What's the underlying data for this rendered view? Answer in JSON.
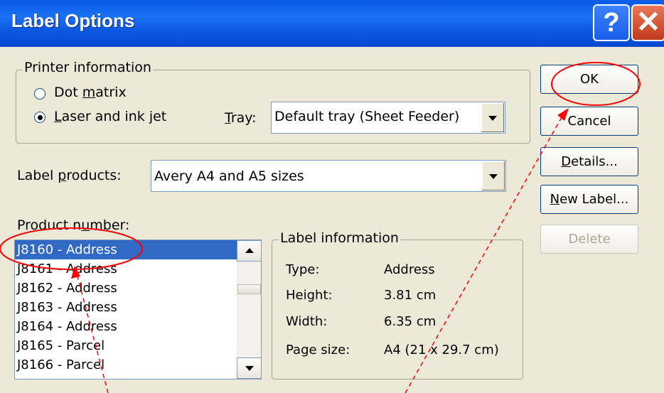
{
  "window": {
    "title": "Label Options"
  },
  "printer_info": {
    "group_title": "Printer information",
    "options": [
      {
        "label_pre": "Dot ",
        "label_u": "m",
        "label_post": "atrix",
        "checked": false
      },
      {
        "label_pre": "",
        "label_u": "L",
        "label_post": "aser and ink jet",
        "checked": true
      }
    ],
    "tray_label_u": "T",
    "tray_label_post": "ray:",
    "tray_value": "Default tray (Sheet Feeder)"
  },
  "label_products": {
    "label_pre": "Label ",
    "label_u": "p",
    "label_post": "roducts:",
    "value": "Avery A4 and A5 sizes"
  },
  "product_number": {
    "label_pre": "Product n",
    "label_u": "u",
    "label_post": "mber:",
    "items": [
      {
        "text": "J8160 - Address",
        "selected": true
      },
      {
        "text": "J8161 - Address",
        "selected": false
      },
      {
        "text": "J8162 - Address",
        "selected": false
      },
      {
        "text": "J8163 - Address",
        "selected": false
      },
      {
        "text": "J8164 - Address",
        "selected": false
      },
      {
        "text": "J8165 - Parcel",
        "selected": false
      },
      {
        "text": "J8166 - Parcel",
        "selected": false
      }
    ]
  },
  "label_info": {
    "group_title": "Label information",
    "rows": [
      {
        "key": "Type:",
        "value": "Address"
      },
      {
        "key": "Height:",
        "value": "3.81 cm"
      },
      {
        "key": "Width:",
        "value": "6.35 cm"
      },
      {
        "key": "Page size:",
        "value": "A4 (21 x 29.7 cm)"
      }
    ]
  },
  "buttons": {
    "ok": "OK",
    "cancel": "Cancel",
    "details_u": "D",
    "details_post": "etails...",
    "new_label_u": "N",
    "new_label_post": "ew Label...",
    "delete": "Delete"
  },
  "colors": {
    "annotation": "#ff0000",
    "selection": "#316ac5",
    "titlebar": "#0b5de8"
  }
}
